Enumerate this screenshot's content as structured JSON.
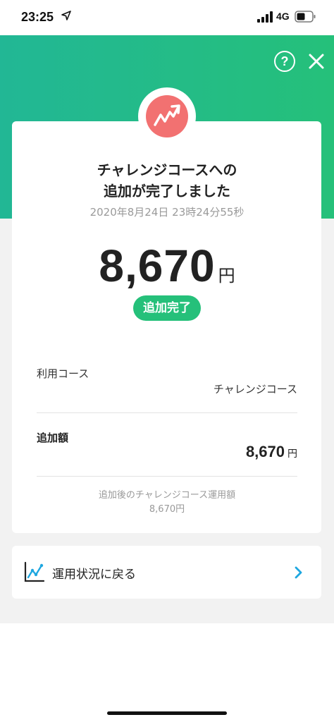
{
  "status_bar": {
    "time": "23:25",
    "network": "4G"
  },
  "header": {
    "help_label": "?",
    "icons": [
      "help-icon",
      "close-icon"
    ]
  },
  "badge": {
    "icon": "chart-up-icon",
    "color": "#f27171"
  },
  "result": {
    "title_line1": "チャレンジコースへの",
    "title_line2": "追加が完了しました",
    "datetime": "2020年8月24日 23時24分55秒",
    "amount": "8,670",
    "unit": "円",
    "status": "追加完了"
  },
  "details": {
    "course_label": "利用コース",
    "course_value": "チャレンジコース",
    "amount_label": "追加額",
    "amount_value": "8,670",
    "amount_unit": "円",
    "note_label": "追加後のチャレンジコース運用額",
    "note_value": "8,670円"
  },
  "link": {
    "label": "運用状況に戻る",
    "icon": "line-chart-icon"
  },
  "colors": {
    "accent_green": "#25c07a",
    "gradient_start": "#22b795",
    "link_chevron": "#1ea7e0"
  }
}
